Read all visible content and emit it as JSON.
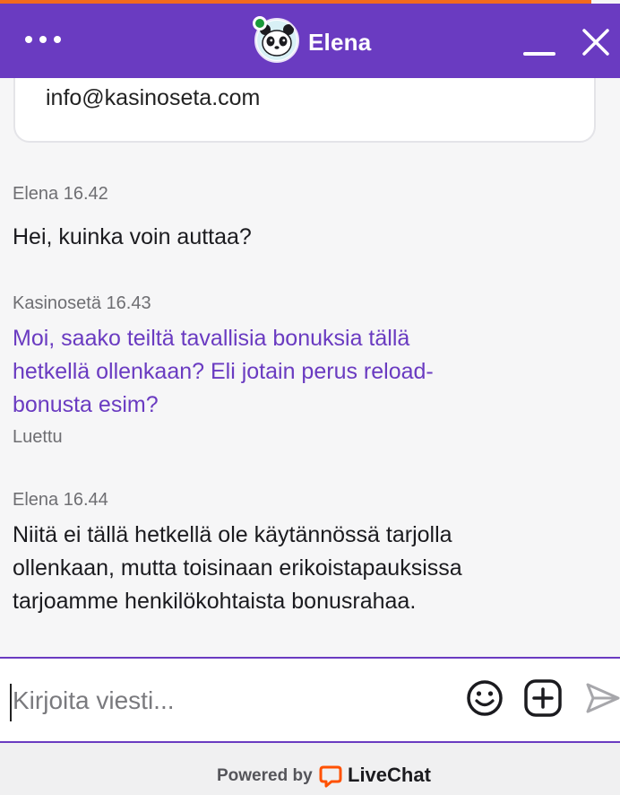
{
  "header": {
    "agent_name": "Elena",
    "status_color": "#1a9a3a",
    "brand_color": "#6a3bc1",
    "accent_stripe_color": "#f26a1e",
    "menu_icon": "more-dots-icon",
    "minimize_icon": "minimize-icon",
    "close_icon": "close-icon"
  },
  "info_card": {
    "email": "info@kasinoseta.com"
  },
  "messages": [
    {
      "author": "Elena",
      "time": "16.42",
      "meta": "Elena 16.42",
      "text": "Hei, kuinka voin auttaa?",
      "own": false
    },
    {
      "author": "Kasinosetä",
      "time": "16.43",
      "meta": "Kasinosetä 16.43",
      "lines": [
        "Moi, saako teiltä tavallisia bonuksia tällä",
        "hetkellä ollenkaan? Eli jotain perus reload-",
        "bonusta esim?"
      ],
      "own": true,
      "status": "Luettu"
    },
    {
      "author": "Elena",
      "time": "16.44",
      "meta": "Elena 16.44",
      "lines": [
        "Niitä ei tällä hetkellä ole käytännössä tarjolla",
        "ollenkaan, mutta toisinaan erikoistapauksissa",
        "tarjoamme henkilökohtaista bonusrahaa."
      ],
      "own": false
    }
  ],
  "composer": {
    "placeholder": "Kirjoita viesti...",
    "value": "",
    "emoji_icon": "emoji-icon",
    "attach_icon": "add-attachment-icon",
    "send_icon": "send-icon"
  },
  "footer": {
    "powered_by": "Powered by",
    "brand": "LiveChat",
    "brand_color": "#ff5100"
  }
}
